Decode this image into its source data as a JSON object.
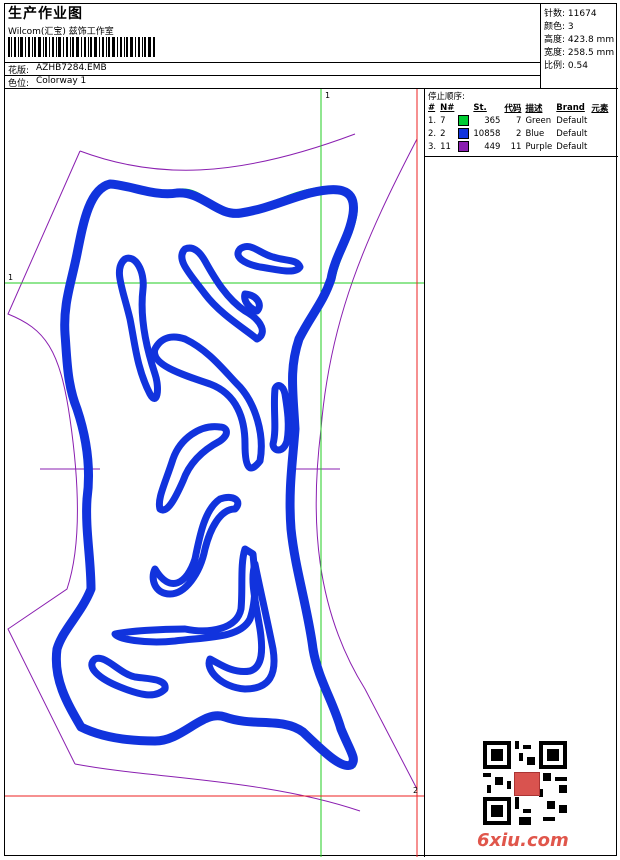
{
  "header": {
    "title": "生产作业图",
    "subtitle": "Wilcom(汇宝) 兹饰工作室",
    "design_label": "花版:",
    "design_value": "AZHB7284.EMB",
    "colorway_label": "色位:",
    "colorway_value": "Colorway 1"
  },
  "stats": [
    {
      "label": "针数:",
      "value": "11674"
    },
    {
      "label": "颜色:",
      "value": "3"
    },
    {
      "label": "高度:",
      "value": "423.8 mm"
    },
    {
      "label": "宽度:",
      "value": "258.5 mm"
    },
    {
      "label": "比例:",
      "value": "0.54"
    }
  ],
  "stop_sequence": {
    "heading": "停止顺序:",
    "columns": [
      "#",
      "N#",
      "",
      "St.",
      "代码",
      "描述",
      "Brand",
      "元素"
    ],
    "rows": [
      {
        "index": "1.",
        "needle": "7",
        "color": "#00cc33",
        "stitches": "365",
        "code": "7",
        "description": "Green",
        "brand": "Default"
      },
      {
        "index": "2.",
        "needle": "2",
        "color": "#1133dd",
        "stitches": "10858",
        "code": "2",
        "description": "Blue",
        "brand": "Default"
      },
      {
        "index": "3.",
        "needle": "11",
        "color": "#8a1fb0",
        "stitches": "449",
        "code": "11",
        "description": "Purple",
        "brand": "Default"
      }
    ]
  },
  "axis_markers": {
    "top": "1",
    "left": "1",
    "bottom_right": "2"
  },
  "watermark": "6xiu.com",
  "colors": {
    "design_blue": "#1133dd",
    "outline_green": "#00cc33",
    "template_purple": "#8a1fb0",
    "guide_green": "#22cc22",
    "guide_red": "#ee2222"
  }
}
